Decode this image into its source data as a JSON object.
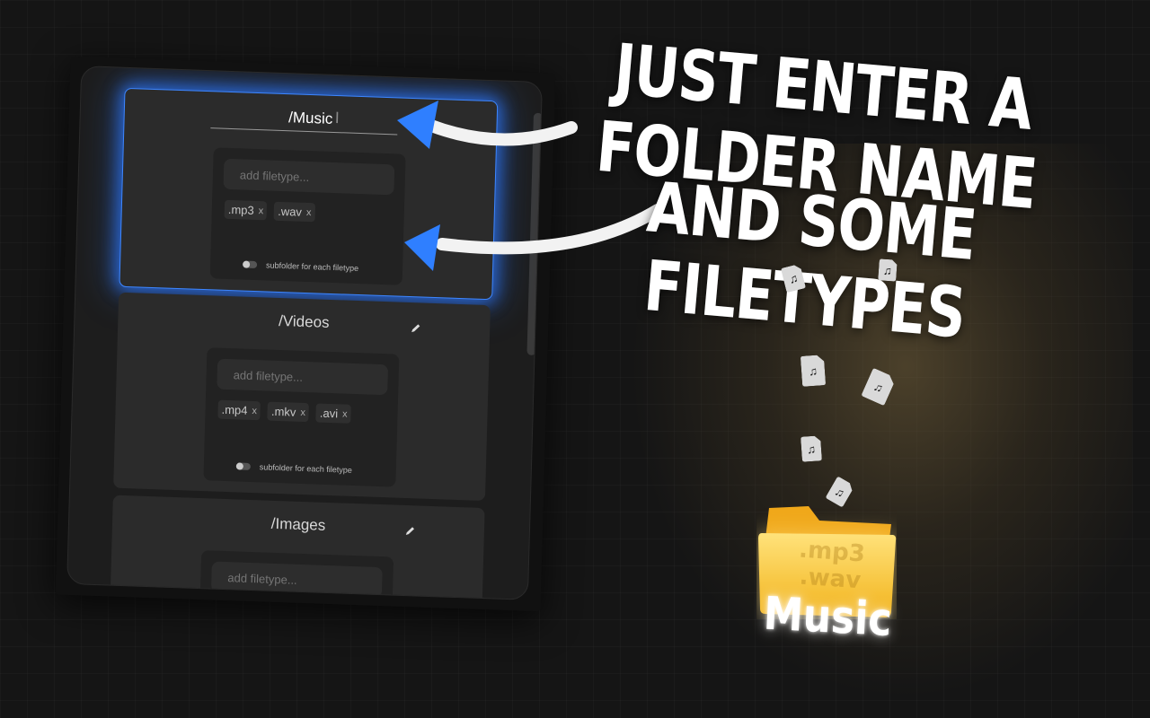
{
  "headline": {
    "line1": "JUST ENTER A FOLDER NAME",
    "line2": "AND SOME FILETYPES"
  },
  "folders": [
    {
      "name": "/Music",
      "placeholder": "add filetype...",
      "filetypes": [
        ".mp3",
        ".wav"
      ],
      "toggle_label": "subfolder for each filetype",
      "active": true
    },
    {
      "name": "/Videos",
      "placeholder": "add filetype...",
      "filetypes": [
        ".mp4",
        ".mkv",
        ".avi"
      ],
      "toggle_label": "subfolder for each filetype",
      "active": false
    },
    {
      "name": "/Images",
      "placeholder": "add filetype...",
      "filetypes": [],
      "active": false
    }
  ],
  "chip_remove": "x",
  "illustration": {
    "folder_label": "Music",
    "folder_extensions": [
      ".mp3",
      ".wav"
    ],
    "note_glyph": "♫",
    "folder_color": "#f7c034",
    "accent_color": "#2f7fff"
  }
}
